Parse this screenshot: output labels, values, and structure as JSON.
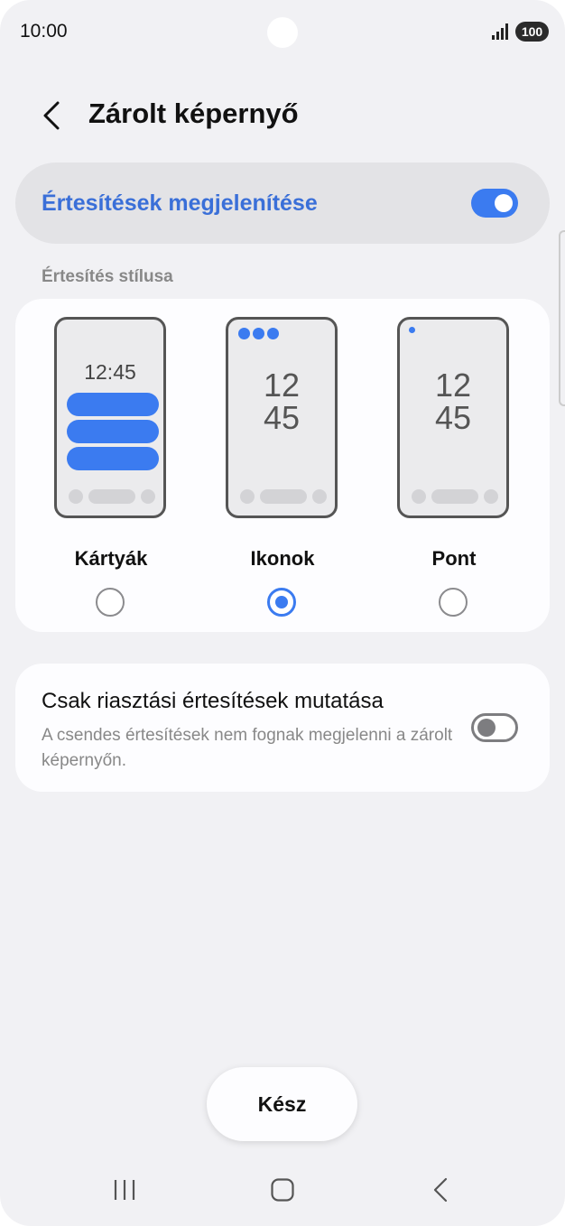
{
  "status_bar": {
    "time": "10:00",
    "battery": "100",
    "icons": [
      "signal-icon",
      "battery-icon"
    ]
  },
  "header": {
    "title": "Zárolt képernyő",
    "back_icon": "back-arrow-icon"
  },
  "master_toggle": {
    "label": "Értesítések megjelenítése",
    "state": "on"
  },
  "notification_style": {
    "section_label": "Értesítés stílusa",
    "options": [
      {
        "label": "Kártyák",
        "preview_time": "12:45",
        "selected": false
      },
      {
        "label": "Ikonok",
        "preview_hour": "12",
        "preview_minute": "45",
        "selected": true
      },
      {
        "label": "Pont",
        "preview_hour": "12",
        "preview_minute": "45",
        "selected": false
      }
    ]
  },
  "alert_only": {
    "title": "Csak riasztási értesítések mutatása",
    "description": "A csendes értesítések nem fognak megjelenni a zárolt képernyőn.",
    "state": "off"
  },
  "done_button": {
    "label": "Kész"
  },
  "nav_bar": {
    "icons": [
      "recents-icon",
      "home-icon",
      "back-icon"
    ]
  },
  "colors": {
    "accent": "#3b7bf0",
    "accent_text": "#3a6fd8",
    "background": "#f1f1f4",
    "card": "#fdfdff"
  }
}
